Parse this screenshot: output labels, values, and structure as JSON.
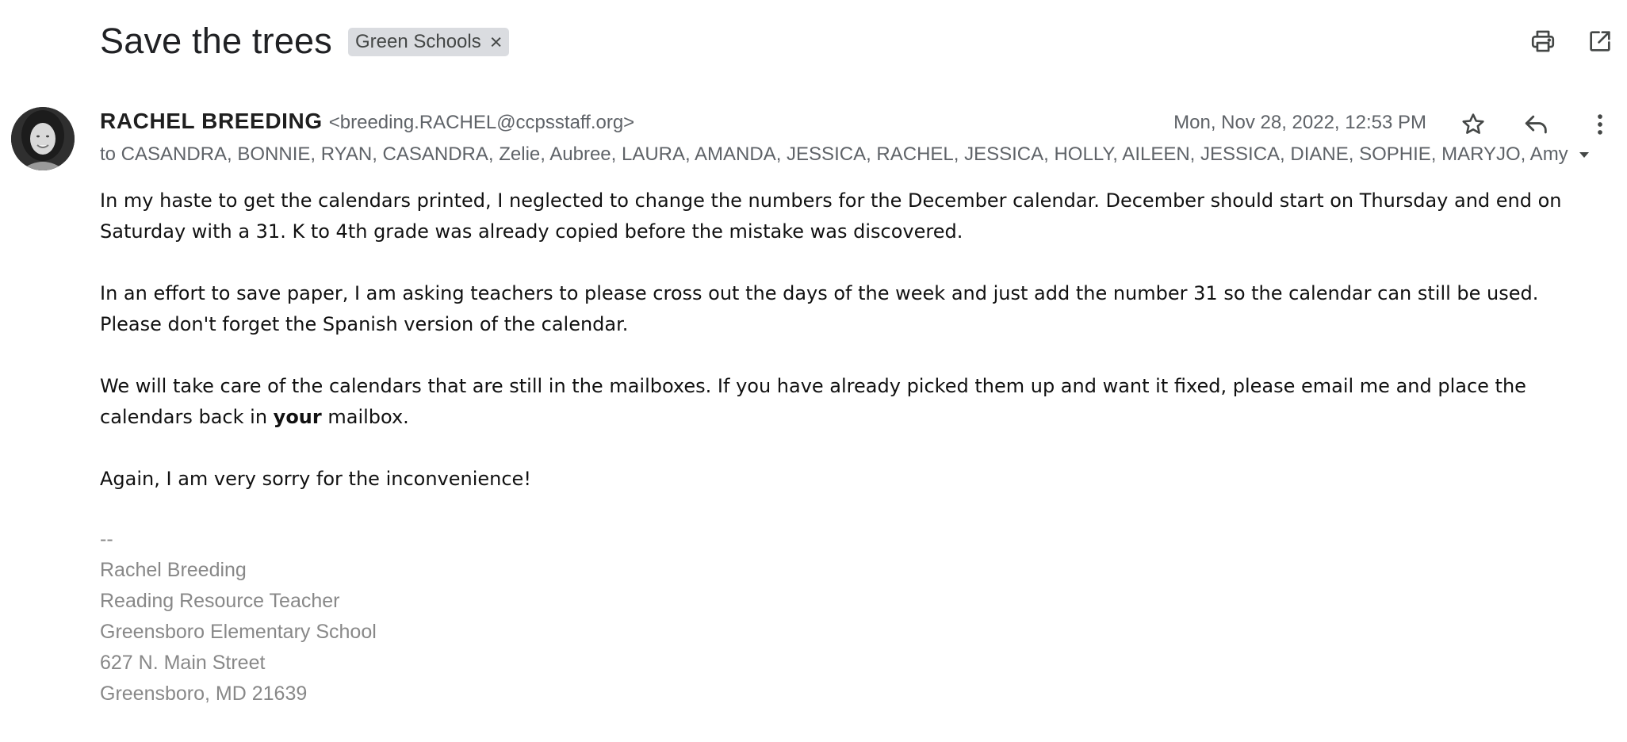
{
  "subject": "Save the trees",
  "label_chip": {
    "text": "Green Schools",
    "close_glyph": "×"
  },
  "toolbar": {
    "print_icon": "print-icon",
    "open_new_window_icon": "open-in-new-icon"
  },
  "message": {
    "sender_name": "RACHEL BREEDING",
    "sender_email": "<breeding.RACHEL@ccpsstaff.org>",
    "date": "Mon, Nov 28, 2022, 12:53 PM",
    "recipients": "to CASANDRA, BONNIE, RYAN, CASANDRA, Zelie, Aubree, LAURA, AMANDA, JESSICA, RACHEL, JESSICA, HOLLY, AILEEN, JESSICA, DIANE, SOPHIE, MARYJO, Amy",
    "actions": {
      "star_icon": "star-icon",
      "reply_icon": "reply-icon",
      "more_icon": "more-vert-icon"
    }
  },
  "body": {
    "p1_line1": "In my haste to get the calendars printed, I neglected to change the numbers for the December calendar.  December should start on Thursday and end on",
    "p1_line2": "Saturday with a 31.  K to 4th grade was already copied before the mistake was discovered.",
    "p2_line1": "In an effort to save paper, I am asking teachers to please cross out the days of the week and just add the number 31 so the calendar can still be used.",
    "p2_line2": "Please don't forget the Spanish version of the calendar.",
    "p3_line1": "We will take care of the calendars that are still in the mailboxes.  If you have already picked them up and want it fixed, please email me and place the",
    "p3_line2_before": "calendars back in ",
    "p3_line2_bold": "your",
    "p3_line2_after": " mailbox.",
    "p4": "Again, I am very sorry for the inconvenience!"
  },
  "signature": {
    "separator": "--",
    "name": "Rachel Breeding",
    "title": "Reading Resource Teacher",
    "school": "Greensboro Elementary School",
    "street": "627 N. Main Street",
    "city": "Greensboro, MD 21639"
  },
  "colors": {
    "text_primary": "#202124",
    "text_secondary": "#5f6368",
    "chip_background": "#dadce0",
    "signature_gray": "#888888"
  }
}
